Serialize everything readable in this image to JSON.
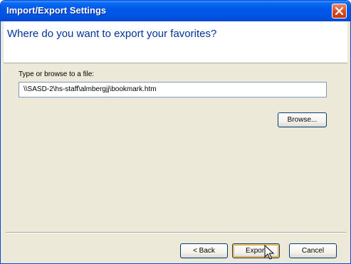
{
  "window": {
    "title": "Import/Export Settings"
  },
  "header": {
    "question": "Where do you want to export your favorites?"
  },
  "form": {
    "label": "Type or browse to a file:",
    "file_path": "\\\\SASD-2\\hs-staff\\almbergjj\\bookmark.htm",
    "browse_label": "Browse..."
  },
  "footer": {
    "back_label": "< Back",
    "export_label": "Export",
    "cancel_label": "Cancel"
  },
  "colors": {
    "titlebar": "#0055e5",
    "header_text": "#003399",
    "dialog_bg": "#ece9d8",
    "close_button": "#d74b24"
  }
}
